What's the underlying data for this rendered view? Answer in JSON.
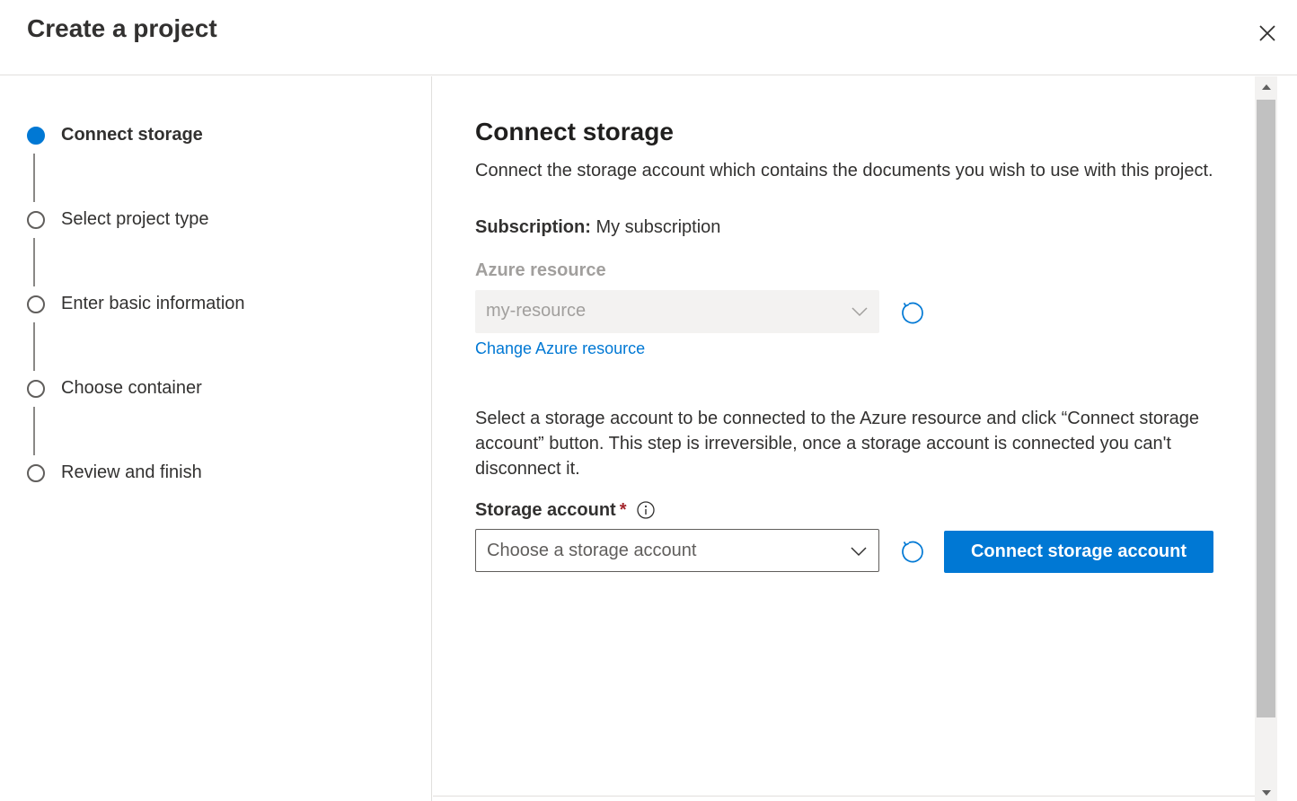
{
  "dialog": {
    "title": "Create a project",
    "close_icon": "close-icon"
  },
  "steps": [
    {
      "label": "Connect storage",
      "state": "active"
    },
    {
      "label": "Select project type",
      "state": "pending"
    },
    {
      "label": "Enter basic information",
      "state": "pending"
    },
    {
      "label": "Choose container",
      "state": "pending"
    },
    {
      "label": "Review and finish",
      "state": "pending"
    }
  ],
  "content": {
    "heading": "Connect storage",
    "description": "Connect the storage account which contains the documents you wish to use with this project.",
    "subscription_key": "Subscription:",
    "subscription_value": "My subscription",
    "azure_resource_label": "Azure resource",
    "azure_resource_value": "my-resource",
    "change_link": "Change Azure resource",
    "instructions": "Select a storage account to be connected to the Azure resource and click “Connect storage account” button. This step is irreversible, once a storage account is connected you can't disconnect it.",
    "storage_label": "Storage account",
    "required_marker": "*",
    "storage_placeholder": "Choose a storage account",
    "connect_button": "Connect storage account"
  },
  "icons": {
    "refresh": "refresh-icon",
    "chevron": "chevron-down-icon",
    "info": "info-icon"
  },
  "colors": {
    "accent": "#0078d4",
    "required": "#a4262c",
    "disabled_text": "#a19f9d",
    "disabled_bg": "#f3f2f1"
  }
}
